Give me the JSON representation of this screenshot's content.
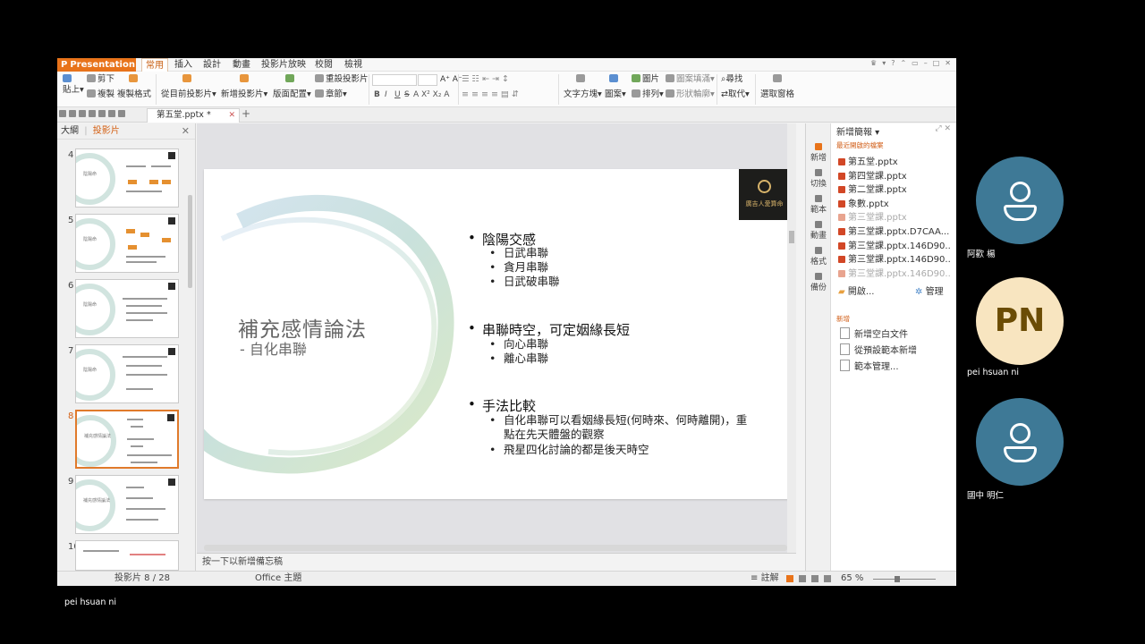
{
  "app": {
    "app_button": "Presentation",
    "menu_tabs": [
      "常用",
      "插入",
      "設計",
      "動畫",
      "投影片放映",
      "校閱",
      "檢視"
    ],
    "active_tab": "常用"
  },
  "ribbon": {
    "paste": "貼上",
    "cut": "剪下",
    "copy": "複製",
    "format_painter": "複製格式",
    "from_current": "從目前投影片",
    "new_slide": "新增投影片",
    "layout": "版面配置",
    "reset_slide": "重設投影片",
    "section": "章節",
    "bold": "B",
    "italic": "I",
    "underline": "U",
    "strike": "S",
    "text_direction": "文字方塊",
    "shapes": "圖案",
    "picture": "圖片",
    "shape_fill": "圖案填滿",
    "arrange": "排列",
    "shape_outline": "形狀輪廓",
    "find": "尋找",
    "replace": "取代",
    "select_pane": "選取窗格"
  },
  "document_tab": {
    "name": "第五堂.pptx *"
  },
  "left_panel": {
    "tab_outline": "大綱",
    "tab_slides": "投影片",
    "thumbnails": [
      {
        "num": "4",
        "title": "陰陽命"
      },
      {
        "num": "5",
        "title": "陰陽命"
      },
      {
        "num": "6",
        "title": "陰陽命"
      },
      {
        "num": "7",
        "title": "陰陽命"
      },
      {
        "num": "8",
        "title": "補充感情論法"
      },
      {
        "num": "9",
        "title": "補充感情論法"
      },
      {
        "num": "10",
        "title": ""
      }
    ],
    "current": "8"
  },
  "slide": {
    "title": "補充感情論法",
    "subtitle": "- 自化串聯",
    "logo_text": "廣吉人愛算命",
    "sections": [
      {
        "heading": "陰陽交感",
        "items": [
          "日武串聯",
          "貪月串聯",
          "日武破串聯"
        ]
      },
      {
        "heading": "串聯時空，可定姻緣長短",
        "items": [
          "向心串聯",
          "離心串聯"
        ]
      },
      {
        "heading": "手法比較",
        "items": [
          "自化串聯可以看姻緣長短(何時來、何時離開)，重",
          "點在先天體盤的觀察",
          "飛星四化討論的都是後天時空"
        ]
      }
    ]
  },
  "notes_placeholder": "按一下以新增備忘稿",
  "right_bar": [
    "新增",
    "切換",
    "範本",
    "動畫",
    "格式",
    "備份"
  ],
  "task_pane": {
    "title": "新增簡報",
    "recent_label": "最近開啟的檔案",
    "files": [
      {
        "name": "第五堂.pptx",
        "dim": false
      },
      {
        "name": "第四堂課.pptx",
        "dim": false
      },
      {
        "name": "第二堂課.pptx",
        "dim": false
      },
      {
        "name": "象數.pptx",
        "dim": false
      },
      {
        "name": "第三堂課.pptx",
        "dim": true
      },
      {
        "name": "第三堂課.pptx.D7CAA...",
        "dim": false
      },
      {
        "name": "第三堂課.pptx.146D90...",
        "dim": false
      },
      {
        "name": "第三堂課.pptx.146D90...",
        "dim": false
      },
      {
        "name": "第三堂課.pptx.146D90...",
        "dim": true
      }
    ],
    "open": "開啟...",
    "manage": "管理",
    "new_label": "新增",
    "new_items": [
      "新增空白文件",
      "從預設範本新增",
      "範本管理..."
    ]
  },
  "status": {
    "slide_position": "投影片 8 / 28",
    "theme": "Office 主題",
    "notes": "註解",
    "zoom": "65 %"
  },
  "participants": [
    {
      "name": "阿歡 楊",
      "initials": ""
    },
    {
      "name": "pei hsuan ni",
      "initials": "PN"
    },
    {
      "name": "國中 明仁",
      "initials": ""
    }
  ],
  "speaker_label": "pei hsuan ni"
}
